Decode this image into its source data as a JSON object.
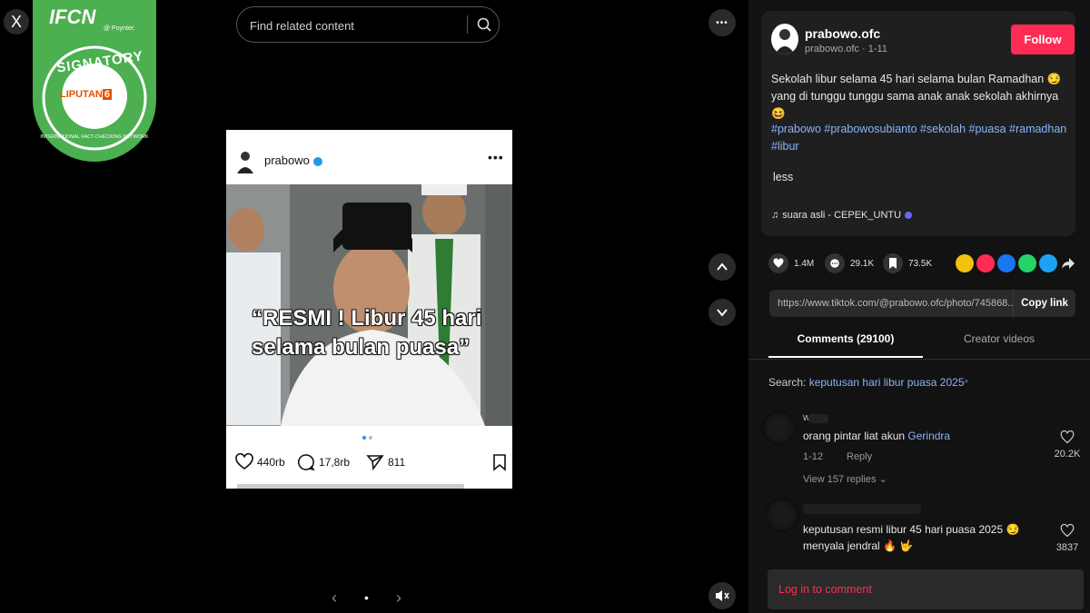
{
  "viewer": {
    "close_icon": "X",
    "badge": {
      "ifcn": "IFCN",
      "poynter": "@ Poynter.",
      "signatory": "SIGNATORY",
      "network": "INTERNATIONAL FACT-CHECKING NETWORK",
      "liputan": "LIPUTAN",
      "liputan_num": "6"
    },
    "search_placeholder": "Find related content",
    "more_icon": "•••",
    "card": {
      "username": "prabowo",
      "more": "•••",
      "caption_line1": "“RESMI ! Libur 45 hari",
      "caption_line2": "selama bulan puasa”",
      "likes": "440rb",
      "comments": "17,8rb",
      "shares": "811"
    },
    "nav_prev": "‹",
    "nav_dot": "•",
    "nav_next": "›"
  },
  "panel": {
    "username": "prabowo.ofc",
    "subline": "prabowo.ofc · 1-11",
    "follow_label": "Follow",
    "description": "Sekolah libur selama 45 hari selama bulan Ramadhan 😏 yang di tunggu tunggu sama anak anak sekolah akhirnya😆",
    "hashtags": "#prabowo #prabowosubianto #sekolah #puasa #ramadhan #libur",
    "less": "less",
    "sound": "suara asli - CEPEK_UNTU",
    "actions": {
      "likes": "1.4M",
      "comments": "29.1K",
      "saves": "73.5K"
    },
    "link": "https://www.tiktok.com/@prabowo.ofc/photo/745868...",
    "copy_link": "Copy link",
    "tab_comments": "Comments (29100)",
    "tab_creator": "Creator videos",
    "search_label": "Search:",
    "search_query": "keputusan hari libur puasa 2025",
    "comments": [
      {
        "name": "w",
        "text": "orang pintar liat akun ",
        "link": "Gerindra",
        "date": "1-12",
        "reply": "Reply",
        "likes": "20.2K",
        "replies": "View 157 replies ⌄"
      },
      {
        "name": "",
        "text1": "keputusan resmi libur 45 hari puasa 2025 😏",
        "text2": "menyala jendral 🔥 🤟",
        "likes": "3837"
      }
    ],
    "login": "Log in to comment"
  },
  "colors": {
    "accent": "#fe2c55",
    "link": "#8ab4f8",
    "badge_green": "#4caf50"
  }
}
